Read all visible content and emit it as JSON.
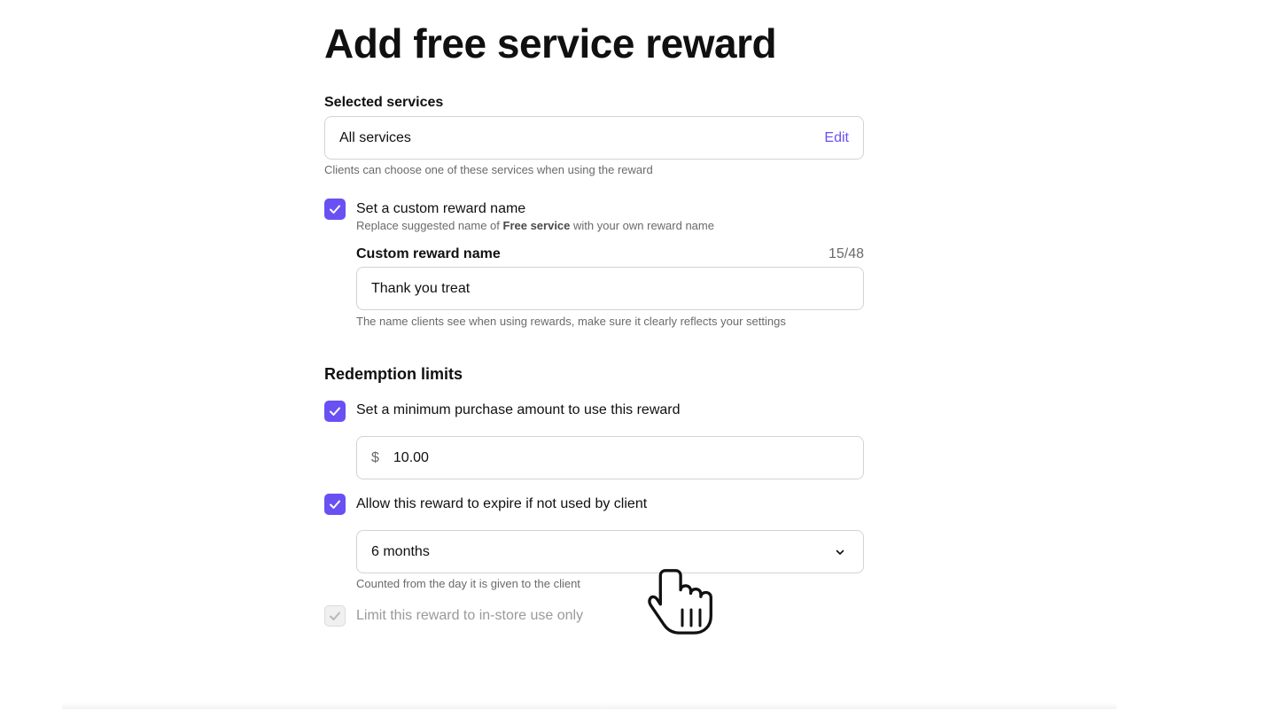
{
  "page": {
    "title": "Add free service reward"
  },
  "selected_services": {
    "label": "Selected services",
    "value": "All services",
    "edit_label": "Edit",
    "hint": "Clients can choose one of these services when using the reward"
  },
  "custom_name": {
    "checkbox_label": "Set a custom reward name",
    "checked": true,
    "description_prefix": "Replace suggested name of ",
    "description_bold": "Free service",
    "description_suffix": " with your own reward name",
    "field_label": "Custom reward name",
    "counter": "15/48",
    "value": "Thank you treat",
    "hint": "The name clients see when using rewards, make sure it clearly reflects your settings"
  },
  "redemption_limits": {
    "title": "Redemption limits",
    "min_purchase": {
      "label": "Set a minimum purchase amount to use this reward",
      "checked": true,
      "currency_symbol": "$",
      "value": "10.00"
    },
    "expire": {
      "label": "Allow this reward to expire if not used by client",
      "checked": true,
      "selected_option": "6 months",
      "hint": "Counted from the day it is given to the client"
    },
    "in_store": {
      "label": "Limit this reward to in-store use only",
      "checked": false
    }
  },
  "icons": {
    "check": "check-icon",
    "dropdown": "chevron-down-icon",
    "cursor": "hand-pointer-icon"
  },
  "colors": {
    "accent": "#6950f3",
    "text": "#101010",
    "muted": "#6a6a6a",
    "border": "#d3d3d3",
    "disabled": "#9a9a9a"
  }
}
